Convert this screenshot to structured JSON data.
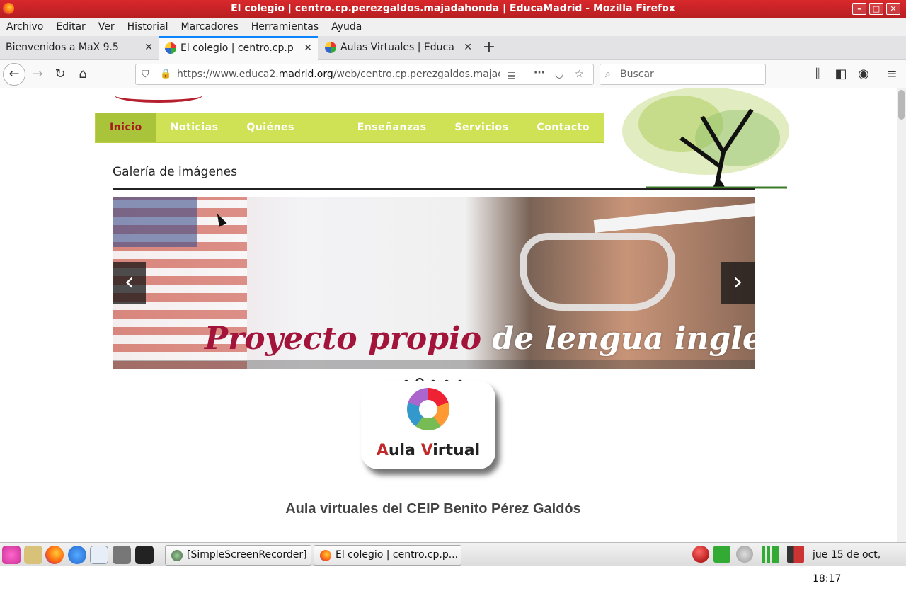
{
  "window": {
    "title": "El colegio | centro.cp.perezgaldos.majadahonda | EducaMadrid - Mozilla Firefox"
  },
  "menubar": {
    "items": [
      "Archivo",
      "Editar",
      "Ver",
      "Historial",
      "Marcadores",
      "Herramientas",
      "Ayuda"
    ]
  },
  "tabs": [
    {
      "label": "Bienvenidos a MaX 9.5"
    },
    {
      "label": "El colegio | centro.cp.perezgaldos"
    },
    {
      "label": "Aulas Virtuales | EducaMadrid"
    }
  ],
  "navbar": {
    "url_prefix": "https://www.educa2.",
    "url_domain": "madrid.org",
    "url_rest": "/web/centro.cp.perezgaldos.majadahonda",
    "search_placeholder": "Buscar"
  },
  "site": {
    "nav": [
      "Inicio",
      "Noticias",
      "Quiénes somos",
      "Enseñanzas",
      "Servicios",
      "Contacto"
    ],
    "gallery_title": "Galería de imágenes",
    "slide_caption_1": "Proyecto propio",
    "slide_caption_2": "de lengua inglesa",
    "slide_count": 5,
    "active_slide": 2,
    "aula_label_a": "A",
    "aula_label_b": "ula ",
    "aula_label_c": "V",
    "aula_label_d": "irtual",
    "aula_heading": "Aula virtuales del CEIP Benito Pérez Galdós"
  },
  "taskbar": {
    "tasks": [
      "[SimpleScreenRecorder]",
      "El colegio | centro.cp.p..."
    ],
    "clock": "jue 15 de oct, 18:17"
  },
  "colors": {
    "nav_bg": "#cfe256",
    "nav_active_bg": "#a9c33a",
    "nav_active_text": "#a51d1d",
    "title_bar": "#c8232a",
    "caption_red": "#a3143a"
  }
}
